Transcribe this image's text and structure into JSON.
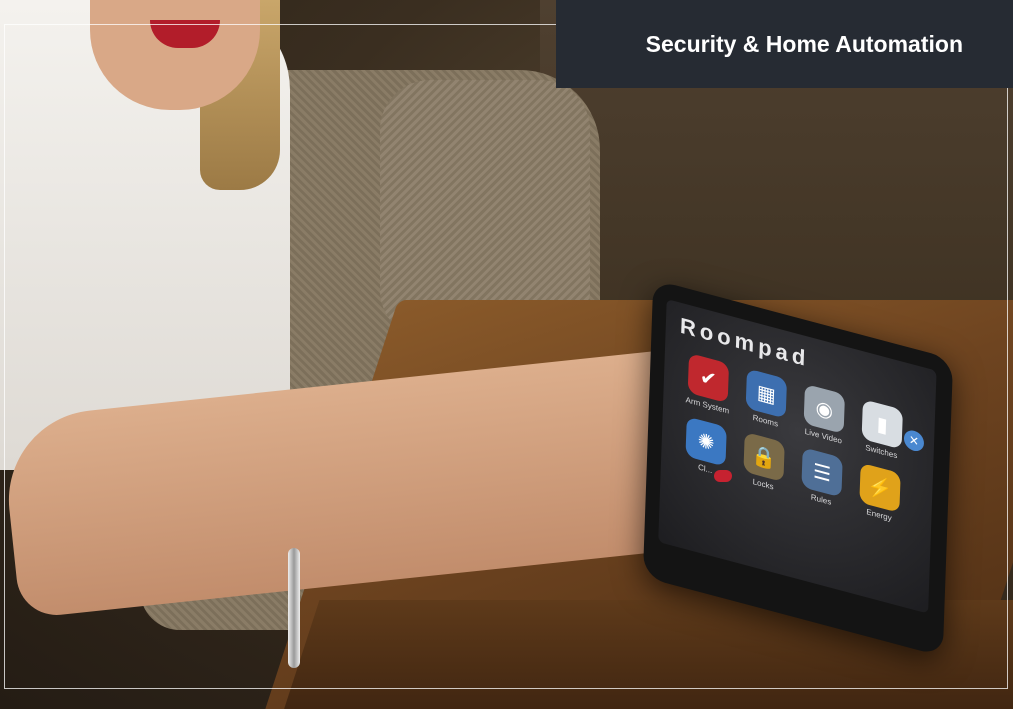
{
  "banner": {
    "title": "Security & Home Automation"
  },
  "device": {
    "brand": "Roompad",
    "close_icon": "close-icon",
    "tiles": [
      {
        "label": "Arm System",
        "icon": "shield-icon",
        "color": "#c0282e"
      },
      {
        "label": "Rooms",
        "icon": "grid-icon",
        "color": "#3d6fb0"
      },
      {
        "label": "Live Video",
        "icon": "camera-icon",
        "color": "#9aa4ae"
      },
      {
        "label": "Switches",
        "icon": "switch-icon",
        "color": "#d8dde2"
      },
      {
        "label": "Cl...",
        "icon": "gear-icon",
        "color": "#3b78c2"
      },
      {
        "label": "Locks",
        "icon": "lock-icon",
        "color": "#7a6a48"
      },
      {
        "label": "Rules",
        "icon": "scroll-icon",
        "color": "#4f6f97"
      },
      {
        "label": "Energy",
        "icon": "bolt-icon",
        "color": "#e0a21a"
      }
    ]
  }
}
